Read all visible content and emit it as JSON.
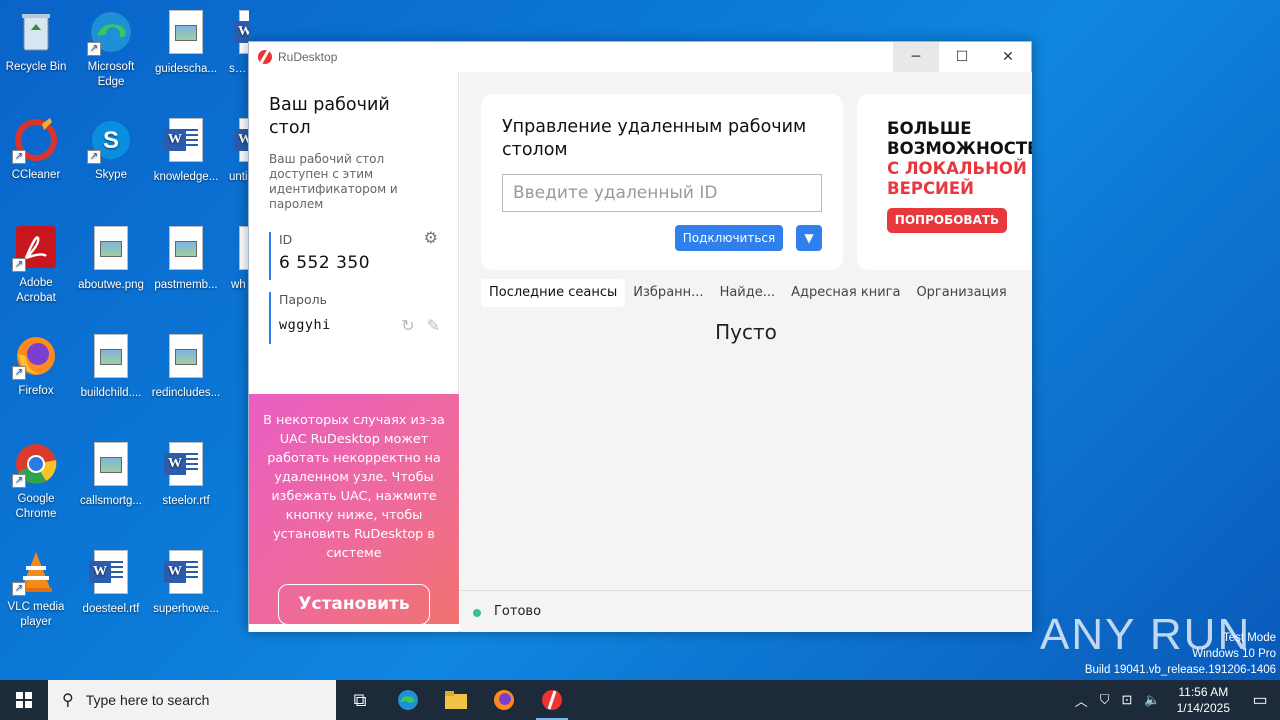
{
  "desktop": {
    "icons": [
      {
        "label": "Recycle Bin"
      },
      {
        "label": "Microsoft Edge"
      },
      {
        "label": "guidescha..."
      },
      {
        "label": "syst"
      },
      {
        "label": "CCleaner"
      },
      {
        "label": "Skype"
      },
      {
        "label": "knowledge..."
      },
      {
        "label": "unti"
      },
      {
        "label": "Adobe Acrobat"
      },
      {
        "label": "aboutwe.png"
      },
      {
        "label": "pastmemb..."
      },
      {
        "label": "wh"
      },
      {
        "label": "Firefox"
      },
      {
        "label": "buildchild...."
      },
      {
        "label": "redincludes..."
      },
      {
        "label": "Google Chrome"
      },
      {
        "label": "callsmortg..."
      },
      {
        "label": "steelor.rtf"
      },
      {
        "label": "VLC media player"
      },
      {
        "label": "doesteel.rtf"
      },
      {
        "label": "superhowe..."
      }
    ]
  },
  "window": {
    "title": "RuDesktop",
    "controls": {
      "minimize": "─",
      "maximize": "☐",
      "close": "✕"
    }
  },
  "left": {
    "heading": "Ваш рабочий стол",
    "description": "Ваш рабочий стол доступен с этим идентификатором и паролем",
    "id_label": "ID",
    "id_value": "6 552 350",
    "password_label": "Пароль",
    "password_value": "wggyhi",
    "uac_text": "В некоторых случаях из-за UAC RuDesktop может работать некорректно на удаленном узле. Чтобы избежать UAC, нажмите кнопку ниже, чтобы установить RuDesktop в системе",
    "install_button": "Установить"
  },
  "remote": {
    "heading": "Управление удаленным рабочим столом",
    "id_placeholder": "Введите удаленный ID",
    "connect_button": "Подключиться"
  },
  "promo": {
    "line1": "БОЛЬШЕ",
    "line2": "ВОЗМОЖНОСТЕЙ",
    "line3": "С ЛОКАЛЬНОЙ",
    "line4": "ВЕРСИЕЙ",
    "button": "ПОПРОБОВАТЬ"
  },
  "tabs": [
    {
      "label": "Последние сеансы"
    },
    {
      "label": "Избранн..."
    },
    {
      "label": "Найде..."
    },
    {
      "label": "Адресная книга"
    },
    {
      "label": "Организация"
    }
  ],
  "empty_text": "Пусто",
  "status": "Готово",
  "watermark": "ANY RUN",
  "windows_info": {
    "line1": "Test Mode",
    "line2": "Windows 10 Pro",
    "line3": "Build 19041.vb_release.191206-1406"
  },
  "taskbar": {
    "search_placeholder": "Type here to search",
    "time": "11:56 AM",
    "date": "1/14/2025"
  },
  "colors": {
    "accent": "#2f80ed",
    "promo_red": "#e8383d",
    "status_green": "#39c08c"
  }
}
